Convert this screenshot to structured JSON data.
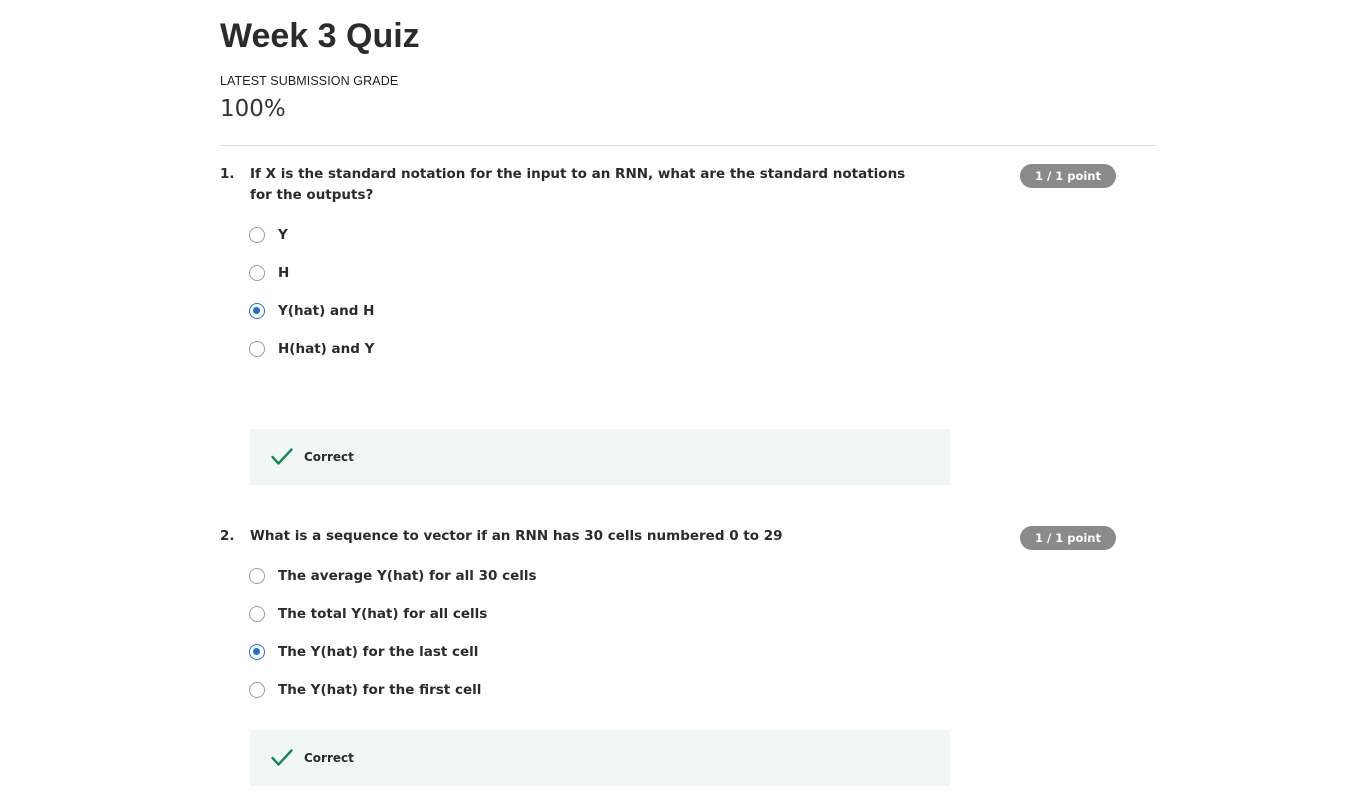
{
  "header": {
    "title": "Week 3 Quiz",
    "grade_label": "LATEST SUBMISSION GRADE",
    "grade_value": "100%"
  },
  "colors": {
    "accent": "#1f6fd1",
    "correct": "#1f8354",
    "feedback_bg": "#f1f7f4",
    "badge_bg": "#8a8a8a"
  },
  "questions": [
    {
      "number": "1.",
      "text": "If X is the standard notation for the input to an RNN, what are the standard notations for the outputs?",
      "points": "1 / 1 point",
      "options": [
        {
          "label": "Y",
          "selected": false
        },
        {
          "label": "H",
          "selected": false
        },
        {
          "label": "Y(hat) and H",
          "selected": true
        },
        {
          "label": "H(hat) and Y",
          "selected": false
        }
      ],
      "feedback": {
        "icon": "checkmark-icon",
        "text": "Correct"
      }
    },
    {
      "number": "2.",
      "text": "What is a sequence to vector if an RNN has 30 cells numbered 0 to 29",
      "points": "1 / 1 point",
      "options": [
        {
          "label": "The average Y(hat) for all 30 cells",
          "selected": false
        },
        {
          "label": "The total Y(hat) for all cells",
          "selected": false
        },
        {
          "label": "The Y(hat) for the last cell",
          "selected": true
        },
        {
          "label": "The Y(hat) for the first cell",
          "selected": false
        }
      ],
      "feedback": {
        "icon": "checkmark-icon",
        "text": "Correct"
      }
    }
  ]
}
